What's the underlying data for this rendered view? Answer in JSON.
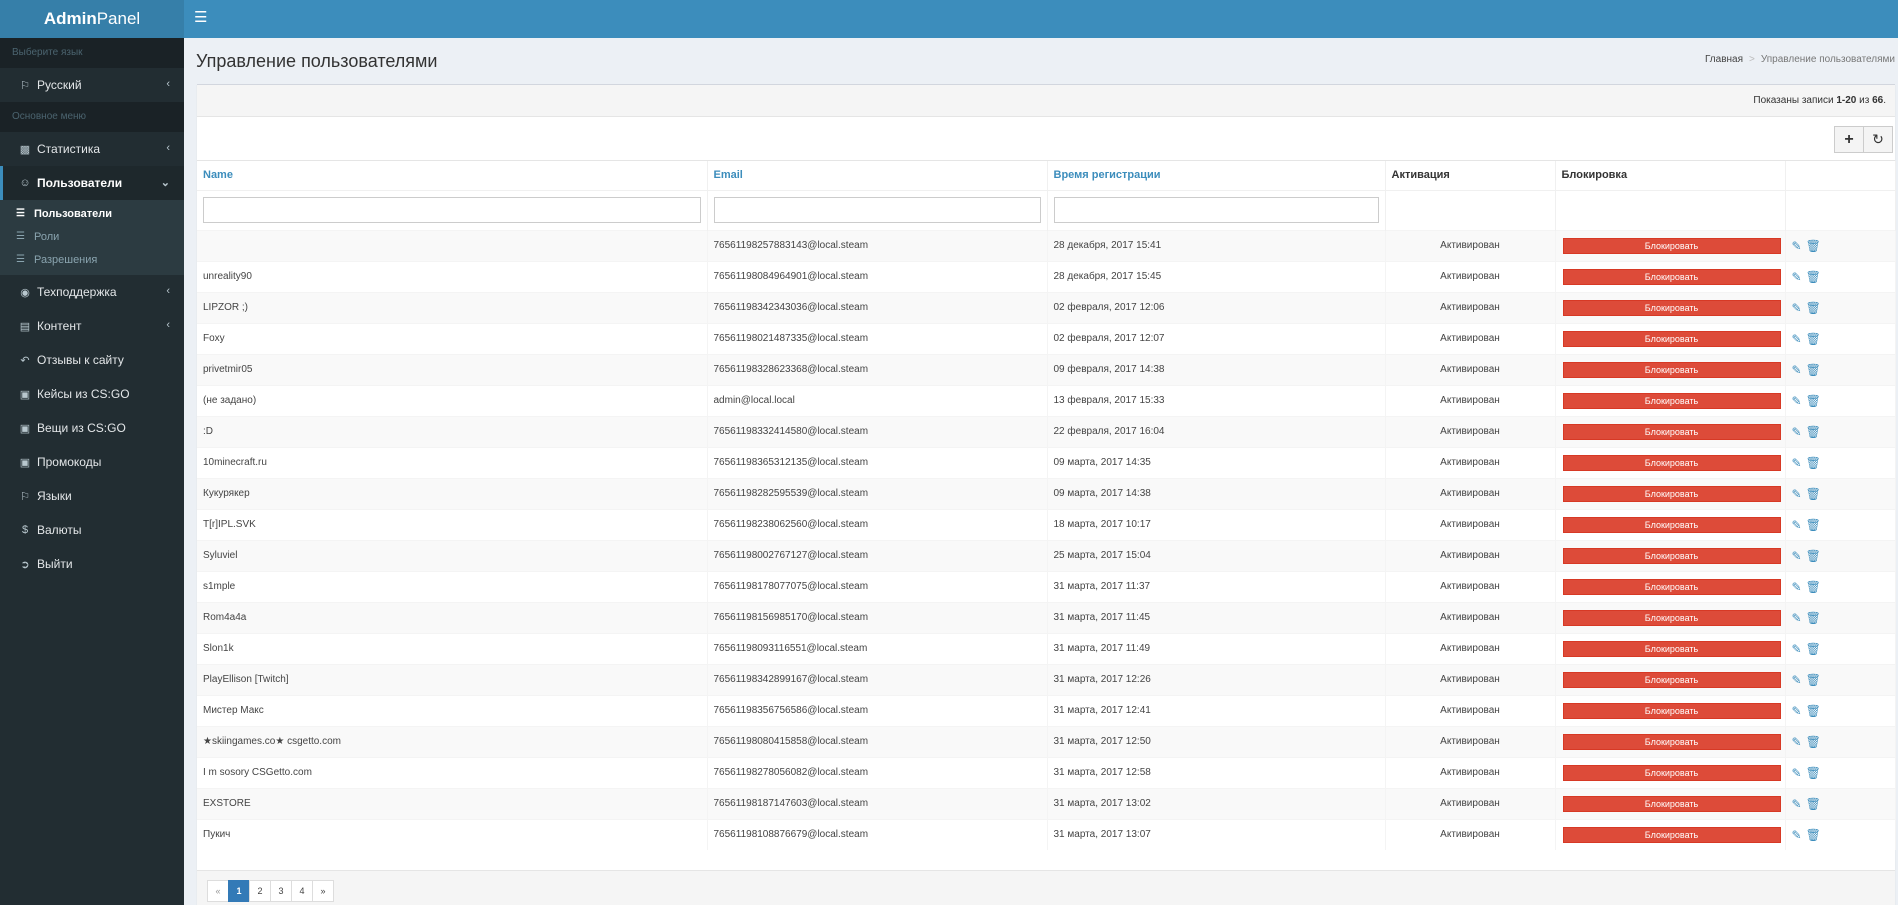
{
  "app": {
    "logo_bold": "Admin",
    "logo_rest": "Panel"
  },
  "sidebar": {
    "lang_header": "Выберите язык",
    "lang_item": "Русский",
    "menu_header": "Основное меню",
    "items": [
      {
        "label": "Статистика",
        "icon": "pie-chart-icon"
      },
      {
        "label": "Пользователи",
        "icon": "users-icon"
      },
      {
        "label": "Техподдержка",
        "icon": "support-icon"
      },
      {
        "label": "Контент",
        "icon": "content-icon"
      },
      {
        "label": "Отзывы к сайту",
        "icon": "reply-icon"
      },
      {
        "label": "Кейсы из CS:GO",
        "icon": "case-icon"
      },
      {
        "label": "Вещи из CS:GO",
        "icon": "items-icon"
      },
      {
        "label": "Промокоды",
        "icon": "promo-icon"
      },
      {
        "label": "Языки",
        "icon": "language-icon"
      },
      {
        "label": "Валюты",
        "icon": "dollar-icon"
      },
      {
        "label": "Выйти",
        "icon": "logout-icon"
      }
    ],
    "subitems": [
      {
        "label": "Пользователи"
      },
      {
        "label": "Роли"
      },
      {
        "label": "Разрешения"
      }
    ]
  },
  "page": {
    "title": "Управление пользователями",
    "breadcrumb_home": "Главная",
    "breadcrumb_current": "Управление пользователями",
    "summary_prefix": "Показаны записи ",
    "summary_range": "1-20",
    "summary_mid": " из ",
    "summary_total": "66",
    "summary_suffix": "."
  },
  "table": {
    "headers": {
      "name": "Name",
      "email": "Email",
      "registered": "Время регистрации",
      "activation": "Активация",
      "blocking": "Блокировка"
    },
    "block_label": "Блокировать",
    "rows": [
      {
        "name": "",
        "email": "76561198257883143@local.steam",
        "date": "28 декабря, 2017 15:41",
        "status": "Активирован"
      },
      {
        "name": "unreality90",
        "email": "76561198084964901@local.steam",
        "date": "28 декабря, 2017 15:45",
        "status": "Активирован"
      },
      {
        "name": "LIPZOR ;)",
        "email": "76561198342343036@local.steam",
        "date": "02 февраля, 2017 12:06",
        "status": "Активирован"
      },
      {
        "name": "Foxy",
        "email": "76561198021487335@local.steam",
        "date": "02 февраля, 2017 12:07",
        "status": "Активирован"
      },
      {
        "name": "privetmir05",
        "email": "76561198328623368@local.steam",
        "date": "09 февраля, 2017 14:38",
        "status": "Активирован"
      },
      {
        "name": "(не задано)",
        "email": "admin@local.local",
        "date": "13 февраля, 2017 15:33",
        "status": "Активирован"
      },
      {
        "name": ":D",
        "email": "76561198332414580@local.steam",
        "date": "22 февраля, 2017 16:04",
        "status": "Активирован"
      },
      {
        "name": "10minecraft.ru",
        "email": "76561198365312135@local.steam",
        "date": "09 марта, 2017 14:35",
        "status": "Активирован"
      },
      {
        "name": "Кукурякер",
        "email": "76561198282595539@local.steam",
        "date": "09 марта, 2017 14:38",
        "status": "Активирован"
      },
      {
        "name": "T[r]IPL.SVK",
        "email": "76561198238062560@local.steam",
        "date": "18 марта, 2017 10:17",
        "status": "Активирован"
      },
      {
        "name": "Syluviel",
        "email": "76561198002767127@local.steam",
        "date": "25 марта, 2017 15:04",
        "status": "Активирован"
      },
      {
        "name": "s1mple",
        "email": "76561198178077075@local.steam",
        "date": "31 марта, 2017 11:37",
        "status": "Активирован"
      },
      {
        "name": "Rom4a4a",
        "email": "76561198156985170@local.steam",
        "date": "31 марта, 2017 11:45",
        "status": "Активирован"
      },
      {
        "name": "Slon1k",
        "email": "76561198093116551@local.steam",
        "date": "31 марта, 2017 11:49",
        "status": "Активирован"
      },
      {
        "name": "PlayEllison [Twitch]",
        "email": "76561198342899167@local.steam",
        "date": "31 марта, 2017 12:26",
        "status": "Активирован"
      },
      {
        "name": "Мистер Макс",
        "email": "76561198356756586@local.steam",
        "date": "31 марта, 2017 12:41",
        "status": "Активирован"
      },
      {
        "name": "★skiingames.co★ csgetto.com",
        "email": "76561198080415858@local.steam",
        "date": "31 марта, 2017 12:50",
        "status": "Активирован"
      },
      {
        "name": "I m sosory CSGetto.com",
        "email": "76561198278056082@local.steam",
        "date": "31 марта, 2017 12:58",
        "status": "Активирован"
      },
      {
        "name": "EXSTORE",
        "email": "76561198187147603@local.steam",
        "date": "31 марта, 2017 13:02",
        "status": "Активирован"
      },
      {
        "name": "Пукич",
        "email": "76561198108876679@local.steam",
        "date": "31 марта, 2017 13:07",
        "status": "Активирован"
      }
    ]
  },
  "pagination": {
    "prev": "«",
    "pages": [
      "1",
      "2",
      "3",
      "4"
    ],
    "current": "1",
    "next": "»"
  },
  "colors": {
    "accent": "#3c8dbc",
    "danger": "#dd4b39",
    "success": "#3c763d",
    "sidebar": "#222d32"
  }
}
